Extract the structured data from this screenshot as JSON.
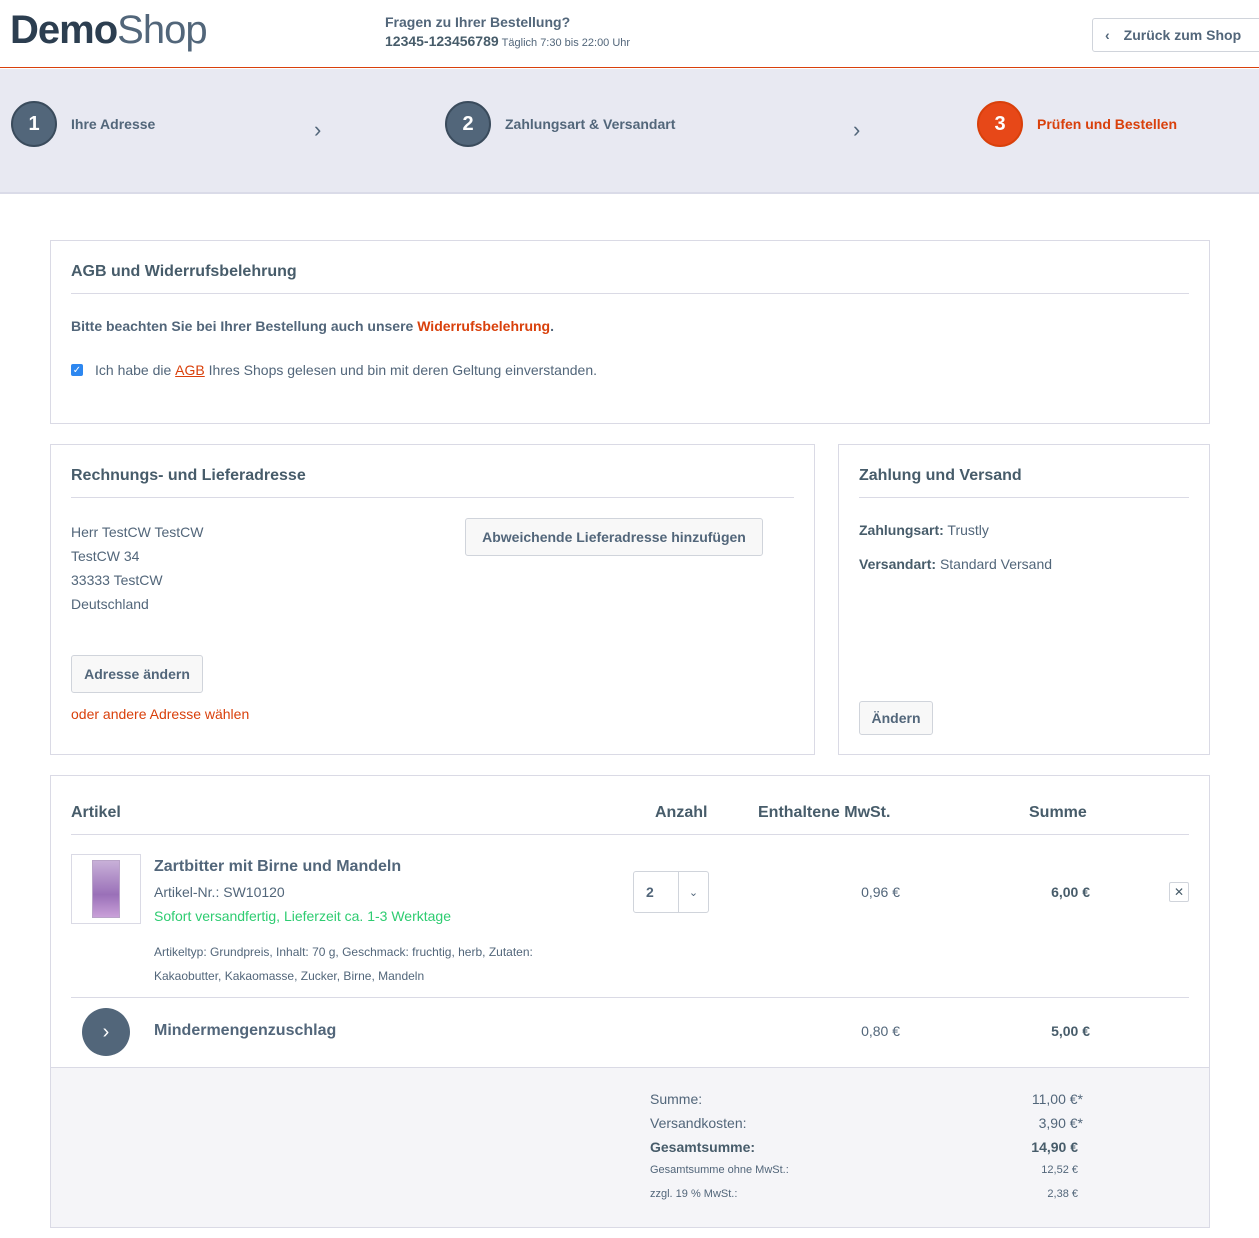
{
  "header": {
    "logo_bold": "Demo",
    "logo_light": "Shop",
    "hotline_question": "Fragen zu Ihrer Bestellung?",
    "hotline_number": "12345-123456789",
    "hotline_hours": "Täglich 7:30 bis 22:00 Uhr",
    "back_label": "Zurück zum Shop"
  },
  "steps": [
    {
      "number": "1",
      "label": "Ihre Adresse"
    },
    {
      "number": "2",
      "label": "Zahlungsart & Versandart"
    },
    {
      "number": "3",
      "label": "Prüfen und Bestellen"
    }
  ],
  "agb": {
    "title": "AGB und Widerrufsbelehrung",
    "note_prefix": "Bitte beachten Sie bei Ihrer Bestellung auch unsere ",
    "note_link": "Widerrufsbelehrung",
    "note_suffix": ".",
    "check_prefix": "Ich habe die ",
    "check_link": "AGB",
    "check_suffix": " Ihres Shops gelesen und bin mit deren Geltung einverstanden."
  },
  "address": {
    "title": "Rechnungs- und Lieferadresse",
    "lines": [
      "Herr TestCW TestCW",
      "TestCW 34",
      "33333 TestCW",
      "Deutschland"
    ],
    "add_shipping_button": "Abweichende Lieferadresse hinzufügen",
    "change_button": "Adresse ändern",
    "other_link": "oder andere Adresse wählen"
  },
  "payment": {
    "title": "Zahlung und Versand",
    "payment_label": "Zahlungsart:",
    "payment_value": "Trustly",
    "shipping_label": "Versandart:",
    "shipping_value": "Standard Versand",
    "change_button": "Ändern"
  },
  "cart": {
    "columns": {
      "article": "Artikel",
      "quantity": "Anzahl",
      "tax": "Enthaltene MwSt.",
      "sum": "Summe"
    },
    "item": {
      "name": "Zartbitter mit Birne und Mandeln",
      "sku": "Artikel-Nr.: SW10120",
      "delivery": "Sofort versandfertig, Lieferzeit ca. 1-3 Werktage",
      "description": "Artikeltyp: Grundpreis, Inhalt: 70 g, Geschmack: fruchtig, herb, Zutaten: Kakaobutter, Kakaomasse, Zucker, Birne, Mandeln",
      "quantity": "2",
      "tax": "0,96 €",
      "sum": "6,00 €",
      "remove": "✕"
    },
    "surcharge": {
      "name": "Mindermengenzuschlag",
      "tax": "0,80 €",
      "sum": "5,00 €"
    },
    "totals": {
      "sum_label": "Summe:",
      "sum_value": "11,00 €*",
      "shipping_label": "Versandkosten:",
      "shipping_value": "3,90 €*",
      "total_label": "Gesamtsumme:",
      "total_value": "14,90 €",
      "net_label": "Gesamtsumme ohne MwSt.:",
      "net_value": "12,52 €",
      "vat_label": "zzgl. 19 % MwSt.:",
      "vat_value": "2,38 €"
    }
  },
  "colors": {
    "accent": "#d9400b",
    "text": "#52667a",
    "success": "#2ecc71",
    "step_bg": "#e8e9f2"
  }
}
